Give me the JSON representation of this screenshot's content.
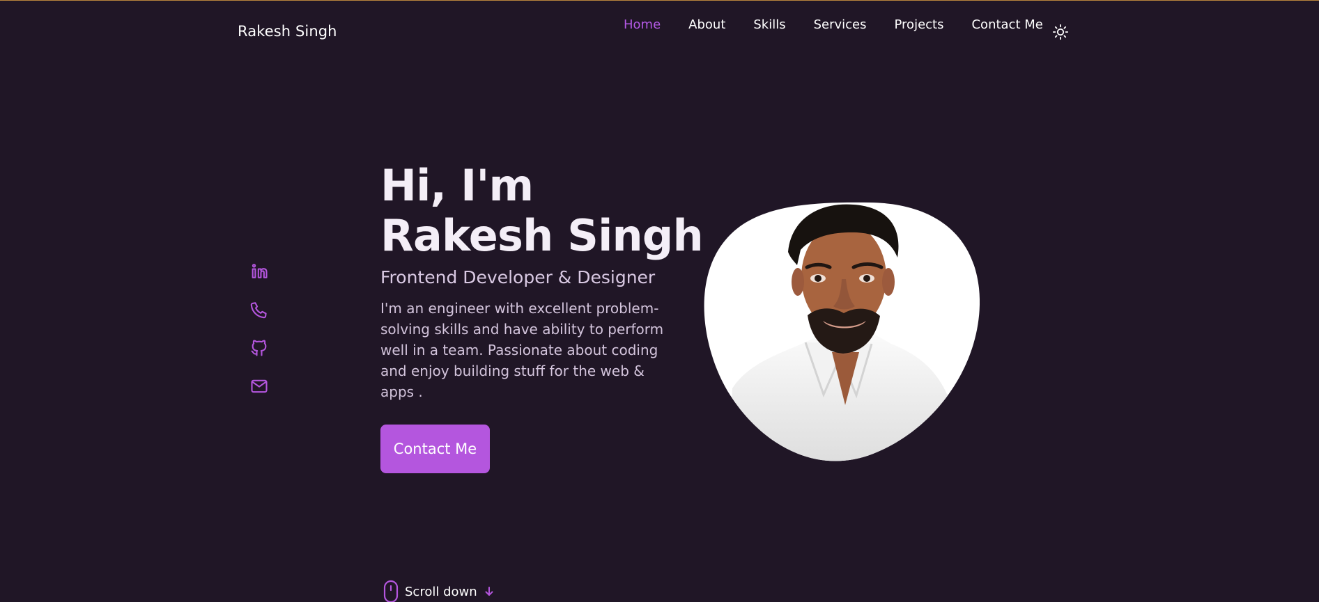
{
  "header": {
    "logo": "Rakesh Singh",
    "nav": [
      {
        "label": "Home",
        "active": true
      },
      {
        "label": "About",
        "active": false
      },
      {
        "label": "Skills",
        "active": false
      },
      {
        "label": "Services",
        "active": false
      },
      {
        "label": "Projects",
        "active": false
      },
      {
        "label": "Contact Me",
        "active": false
      }
    ],
    "theme_icon": "sun-icon"
  },
  "social": [
    {
      "name": "linkedin-icon"
    },
    {
      "name": "phone-icon"
    },
    {
      "name": "github-icon"
    },
    {
      "name": "mail-icon"
    }
  ],
  "hero": {
    "title_line1": "Hi, I'm",
    "title_line2": "Rakesh Singh",
    "subtitle": "Frontend Developer & Designer",
    "description": "I'm an engineer with excellent problem-solving skills and have ability to perform well in a team. Passionate about coding and enjoy building stuff for the web & apps .",
    "button_label": "Contact Me"
  },
  "scroll": {
    "label": "Scroll down"
  },
  "colors": {
    "background": "#201626",
    "accent": "#b456de",
    "active_nav": "#b55ae7",
    "text": "#f4eef7",
    "muted_text": "#d3c4dc"
  }
}
